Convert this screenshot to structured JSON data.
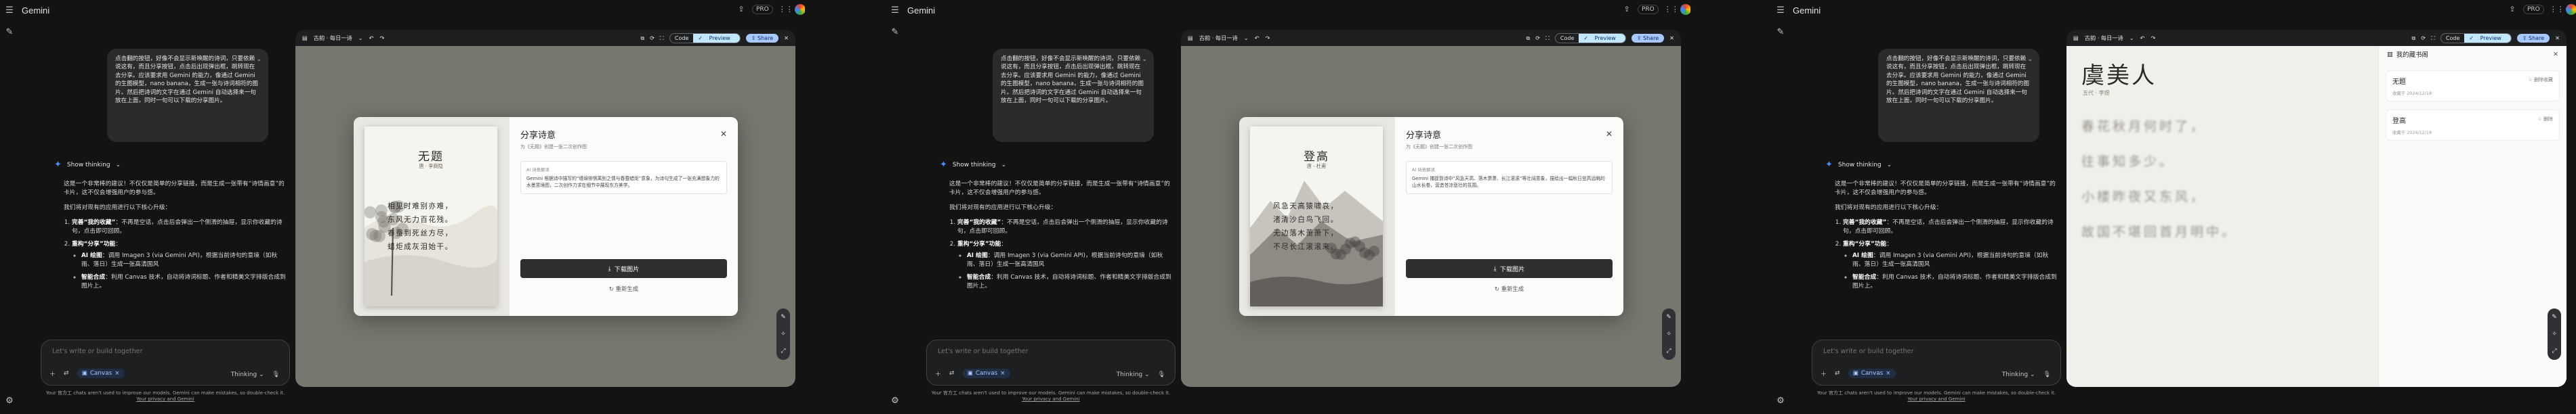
{
  "app": {
    "name": "Gemini",
    "plan_badge": "PRO"
  },
  "chat": {
    "user_message": "点击翻的按钮，好像不会显示新唤醒的诗词，只要依赖说这有，而且分享按钮，点击后出现弹出框，跳转现在去分享。应该要求用 Gemini 的能力，像通过 Gemini 的生图模型，nano banana，生成一张与诗词相符的图片。然后把诗词的文字在通过 Gemini 自动选择来一句放在上面，同时一句可以下载的分享图片。",
    "show_thinking": "Show thinking",
    "answer_intro": "这是一个非常棒的建议！不仅仅是简单的分享链接，而是生成一张带有“诗情画意”的卡片，这不仅会增强用户的参与感。",
    "answer_intro2": "我们将对现有的应用进行以下核心升级：",
    "items": [
      {
        "title": "完善“我的收藏”",
        "text": "不再是空话，点击后会弹出一个侧滑的抽屉，显示你收藏的诗句，点击即可回顾。"
      },
      {
        "title": "重构“分享”功能",
        "subs": [
          {
            "title": "AI 绘图",
            "text": "调用 Imagen 3 (via Gemini API)，根据当前诗句的意境（如秋雨、落日）生成一张高清国风"
          },
          {
            "title": "智能合成",
            "text": "利用 Canvas 技术，自动将诗词标题、作者和精美文字排版合成到图片上。"
          }
        ]
      }
    ]
  },
  "input": {
    "placeholder": "Let's write or build together",
    "canvas_chip": "Canvas",
    "mode": "Thinking"
  },
  "disclaimer": {
    "text": "Your 官方工 chats aren't used to improve our models. Gemini can make mistakes, so double-check it.",
    "link": "Your privacy and Gemini"
  },
  "canvas": {
    "title": "古韵 · 每日一诗",
    "code_tab": "Code",
    "preview_tab": "Preview",
    "share_button": "Share"
  },
  "share_modal": {
    "title": "分享诗意",
    "subtitle": "为《无题》创建一张二次创作图",
    "ai_label": "AI 诗意解读",
    "download": "下载图片",
    "regenerate": "重新生成"
  },
  "panels": [
    {
      "poem": {
        "title": "无题",
        "author": "唐 · 李商隐",
        "lines": [
          "相见时难别亦难，",
          "东风无力百花残。",
          "春蚕到死丝方尽，",
          "蜡炬成灰泪始干。"
        ]
      },
      "ai_text": "Gemini 根据诗中描写的“缠绵悱恻离别之情与春蚕蜡炬”意象，为诗句生成了一张充满想象力的水墨意境图，二次创作力求在细节中展现东方美学。"
    },
    {
      "poem": {
        "title": "登高",
        "author": "唐 · 杜甫",
        "lines": [
          "风急天高猿啸哀，",
          "渚清沙白鸟飞回。",
          "无边落木萧萧下，",
          "不尽长江滚滚来。"
        ]
      },
      "ai_text": "Gemini 捕捉到诗中“风急天高、落木萧萧、长江滚滚”等壮阔意象，描绘出一幅秋日登高远眺的山水长卷，营造苍凉悲壮的氛围。"
    }
  ],
  "reader": {
    "title": "虞美人",
    "meta": "五代 · 李煜",
    "lines": [
      "春花秋月何时了，",
      "往事知多少。",
      "小楼昨夜又东风，",
      "故国不堪回首月明中。"
    ]
  },
  "favorites": {
    "title": "我的藏书阁",
    "items": [
      {
        "title": "无题",
        "date": "收藏于 2024/12/18",
        "action": "删除收藏"
      },
      {
        "title": "登高",
        "date": "收藏于 2024/12/18",
        "action": "删除"
      }
    ]
  }
}
